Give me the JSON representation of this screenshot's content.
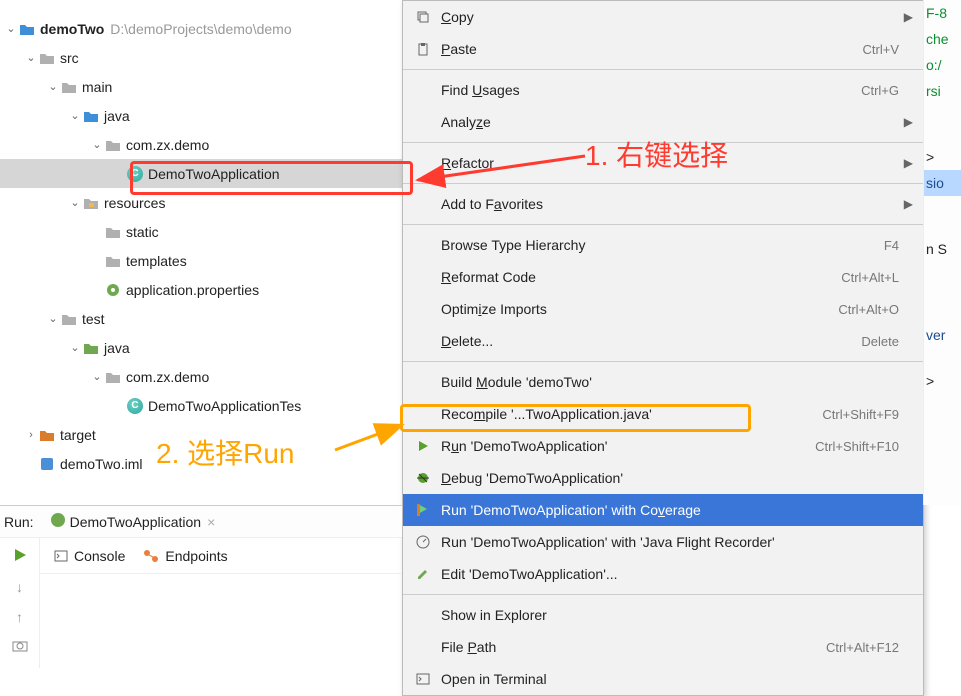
{
  "project": {
    "name": "demoTwo",
    "path": "D:\\demoProjects\\demo\\demo"
  },
  "tree": {
    "src": "src",
    "main": "main",
    "java_main": "java",
    "pkg_main": "com.zx.demo",
    "class_main": "DemoTwoApplication",
    "resources": "resources",
    "static": "static",
    "templates": "templates",
    "props": "application.properties",
    "test": "test",
    "java_test": "java",
    "pkg_test": "com.zx.demo",
    "class_test": "DemoTwoApplicationTes",
    "target": "target",
    "iml": "demoTwo.iml"
  },
  "menu": {
    "copy": "Copy",
    "paste": "Paste",
    "paste_sc": "Ctrl+V",
    "find_usages": "Find Usages",
    "find_usages_sc": "Ctrl+G",
    "analyze": "Analyze",
    "refactor": "Refactor",
    "add_fav": "Add to Favorites",
    "browse_hier": "Browse Type Hierarchy",
    "browse_hier_sc": "F4",
    "reformat": "Reformat Code",
    "reformat_sc": "Ctrl+Alt+L",
    "opt_imports": "Optimize Imports",
    "opt_imports_sc": "Ctrl+Alt+O",
    "delete": "Delete...",
    "delete_sc": "Delete",
    "build": "Build Module 'demoTwo'",
    "recompile": "Recompile '...TwoApplication.java'",
    "recompile_sc": "Ctrl+Shift+F9",
    "run": "Run 'DemoTwoApplication'",
    "run_sc": "Ctrl+Shift+F10",
    "debug": "Debug 'DemoTwoApplication'",
    "coverage": "Run 'DemoTwoApplication' with Coverage",
    "jfr": "Run 'DemoTwoApplication' with 'Java Flight Recorder'",
    "edit": "Edit 'DemoTwoApplication'...",
    "show_explorer": "Show in Explorer",
    "file_path": "File Path",
    "file_path_sc": "Ctrl+Alt+F12",
    "open_terminal": "Open in Terminal"
  },
  "run_panel": {
    "label": "Run:",
    "config": "DemoTwoApplication",
    "console": "Console",
    "endpoints": "Endpoints"
  },
  "code_fragments": {
    "l1": "F-8",
    "l2": "che",
    "l3": "o:/",
    "l4": "rsi",
    "l5": ">",
    "l6": "sio",
    "l7": "n S",
    "l8": "ver",
    "l9": ">"
  },
  "annotations": {
    "step1": "1. 右键选择",
    "step2": "2. 选择Run"
  }
}
